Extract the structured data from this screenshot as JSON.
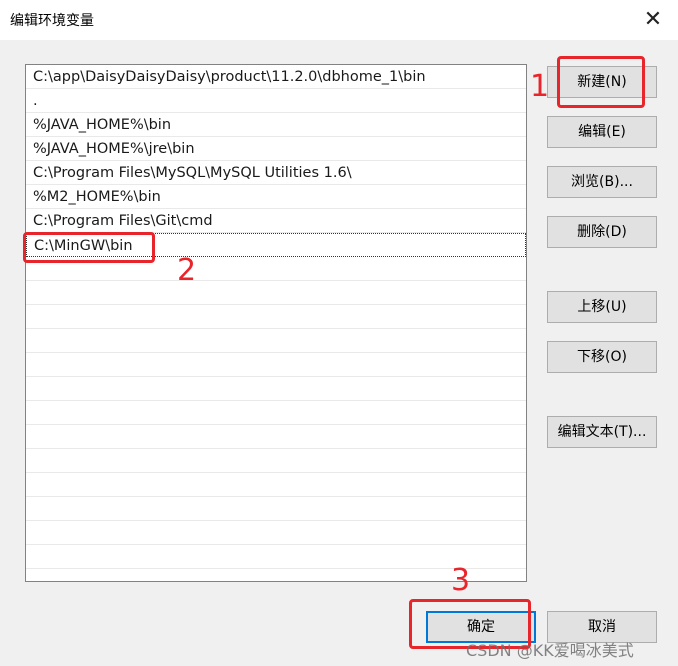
{
  "window": {
    "title": "编辑环境变量",
    "close_glyph": "✕"
  },
  "paths": [
    "C:\\app\\DaisyDaisyDaisy\\product\\11.2.0\\dbhome_1\\bin",
    ".",
    "%JAVA_HOME%\\bin",
    "%JAVA_HOME%\\jre\\bin",
    "C:\\Program Files\\MySQL\\MySQL Utilities 1.6\\",
    "%M2_HOME%\\bin",
    "C:\\Program Files\\Git\\cmd",
    "C:\\MinGW\\bin"
  ],
  "buttons": {
    "new": "新建(N)",
    "edit": "编辑(E)",
    "browse": "浏览(B)...",
    "delete": "删除(D)",
    "move_up": "上移(U)",
    "move_down": "下移(O)",
    "edit_text": "编辑文本(T)...",
    "ok": "确定",
    "cancel": "取消"
  },
  "annotations": {
    "step1": "1",
    "step2": "2",
    "step3": "3"
  },
  "watermark": "CSDN @KK爱喝冰美式",
  "colors": {
    "annotation_red": "#e8252a",
    "focus_blue": "#0078d7"
  }
}
